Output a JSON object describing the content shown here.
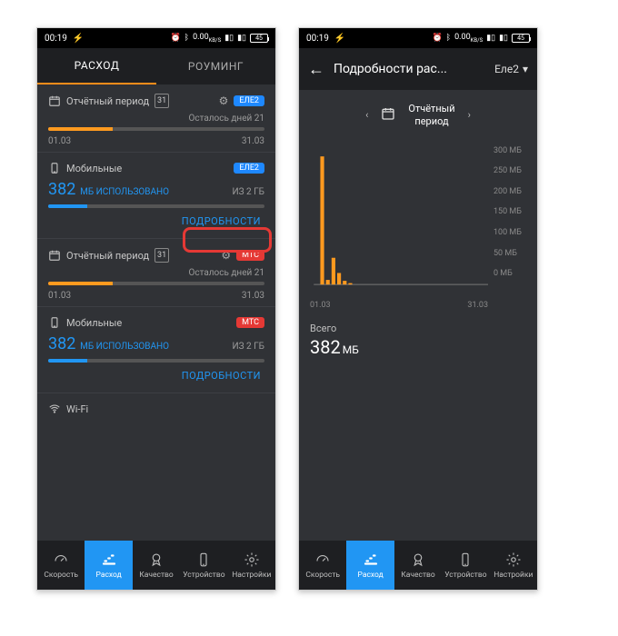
{
  "status": {
    "time": "00:19",
    "battery": "45"
  },
  "phone_left": {
    "tabs": {
      "usage": "РАСХОД",
      "roaming": "РОУМИНГ"
    },
    "period1": {
      "title": "Отчётный период",
      "day": "31",
      "provider": "ЕЛЕ2",
      "remaining": "Осталось дней 21",
      "from": "01.03",
      "to": "31.03",
      "fill_pct": 30
    },
    "mobile1": {
      "title": "Мобильные",
      "provider": "ЕЛЕ2",
      "used_value": "382",
      "used_unit": "МБ ИСПОЛЬЗОВАНО",
      "of": "ИЗ 2 ГБ",
      "details": "ПОДРОБНОСТИ",
      "fill_pct": 18
    },
    "period2": {
      "title": "Отчётный период",
      "day": "31",
      "provider": "МТС",
      "remaining": "Осталось дней 21",
      "from": "01.03",
      "to": "31.03",
      "fill_pct": 30
    },
    "mobile2": {
      "title": "Мобильные",
      "provider": "МТС",
      "used_value": "382",
      "used_unit": "МБ ИСПОЛЬЗОВАНО",
      "of": "ИЗ 2 ГБ",
      "details": "ПОДРОБНОСТИ",
      "fill_pct": 18
    },
    "wifi": {
      "title": "Wi-Fi"
    }
  },
  "phone_right": {
    "appbar": {
      "title": "Подробности рас...",
      "selector": "Еле2"
    },
    "period": {
      "label_line1": "Отчётный",
      "label_line2": "период"
    },
    "xaxis": {
      "from": "01.03",
      "to": "31.03"
    },
    "total_label": "Всего",
    "total_value": "382",
    "total_unit": "МБ"
  },
  "bottom_nav": {
    "items": [
      {
        "label": "Скорость"
      },
      {
        "label": "Расход"
      },
      {
        "label": "Качество"
      },
      {
        "label": "Устройство"
      },
      {
        "label": "Настройки"
      }
    ]
  },
  "chart_data": {
    "type": "bar",
    "xrange_labels": [
      "01.03",
      "31.03"
    ],
    "ylabel": "МБ",
    "ylim": [
      0,
      300
    ],
    "yticks": [
      0,
      50,
      100,
      150,
      200,
      250,
      300
    ],
    "bars": [
      {
        "x_index": 2,
        "value": 278
      },
      {
        "x_index": 3,
        "value": 10
      },
      {
        "x_index": 4,
        "value": 58
      },
      {
        "x_index": 5,
        "value": 25
      },
      {
        "x_index": 6,
        "value": 8
      },
      {
        "x_index": 7,
        "value": 3
      }
    ],
    "x_slot_count": 31
  }
}
